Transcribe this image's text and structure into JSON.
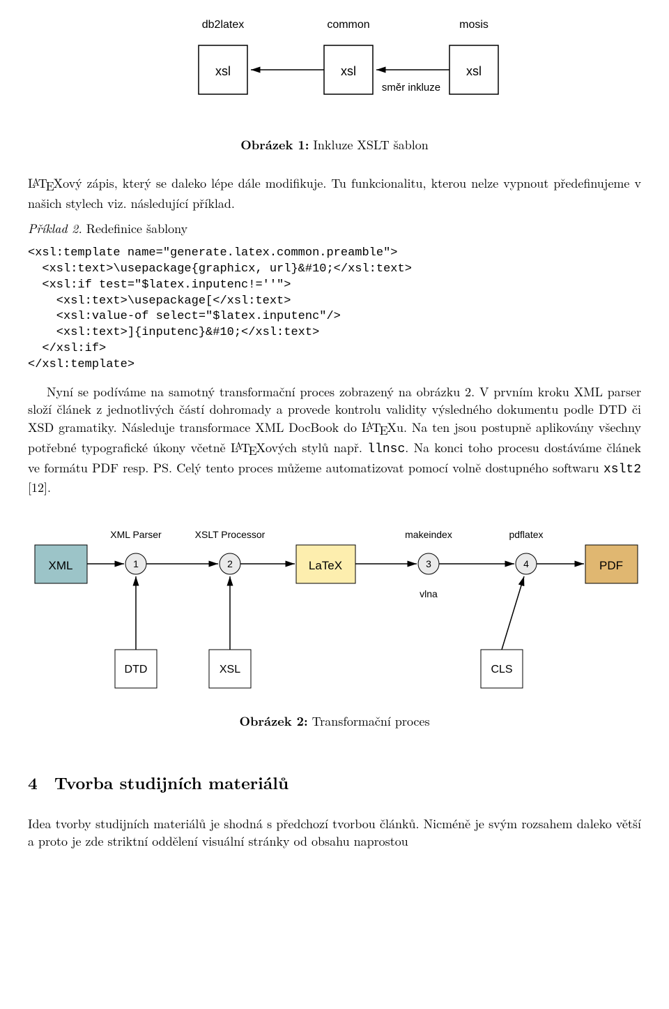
{
  "fig1": {
    "nodes": {
      "db2latex": "db2latex",
      "common": "common",
      "mosis": "mosis",
      "xsl": "xsl"
    },
    "arrowLabel": "směr inkluze",
    "caption_bold": "Obrázek 1:",
    "caption_text": " Inkluze XSLT šablon"
  },
  "para1": "ový zápis, který se daleko lépe dále modifikuje. Tu funkcionalitu, kterou nelze vypnout předefinujeme v našich stylech viz. následující příklad.",
  "example_label": "Příklad 2.",
  "example_title": " Redefinice šablony",
  "code": "<xsl:template name=\"generate.latex.common.preamble\">\n  <xsl:text>\\usepackage{graphicx, url}&#10;</xsl:text>\n  <xsl:if test=\"$latex.inputenc!=''\">\n    <xsl:text>\\usepackage[</xsl:text>\n    <xsl:value-of select=\"$latex.inputenc\"/>\n    <xsl:text>]{inputenc}&#10;</xsl:text>\n  </xsl:if>\n</xsl:template>",
  "para2a": "Nyní se podíváme na samotný transformační proces zobrazený na obrázku 2. V prvním kroku XML parser složí článek z jednotlivých částí dohromady a provede kontrolu validity výsledného dokumentu podle DTD či XSD gramatiky. Následuje transformace XML DocBook do ",
  "para2b": "u. Na ten jsou postupně aplikovány všechny potřebné typografické úkony včetně ",
  "para2c": "ových stylů např. ",
  "para2_tt1": "llnsc",
  "para2d": ". Na konci toho procesu dostáváme článek ve formátu PDF resp. PS. Celý tento proces můžeme automatizovat pomocí volně dostupného softwaru ",
  "para2_tt2": "xslt2",
  "para2e": " [12].",
  "fig2": {
    "nodes": {
      "xml": "XML",
      "latex": "LaTeX",
      "pdf": "PDF",
      "dtd": "DTD",
      "xsl": "XSL",
      "cls": "CLS",
      "n1": "1",
      "n2": "2",
      "n3": "3",
      "n4": "4"
    },
    "labels": {
      "xmlparser": "XML Parser",
      "xsltproc": "XSLT Processor",
      "makeindex": "makeindex",
      "pdflatex": "pdflatex",
      "vlna": "vlna"
    },
    "caption_bold": "Obrázek 2:",
    "caption_text": " Transformační proces"
  },
  "section": {
    "num": "4",
    "title": "Tvorba studijních materiálů"
  },
  "para3": "Idea tvorby studijních materiálů je shodná s předchozí tvorbou článků. Nicméně je svým rozsahem daleko větší a proto je zde striktní oddělení visuální stránky od obsahu naprostou"
}
